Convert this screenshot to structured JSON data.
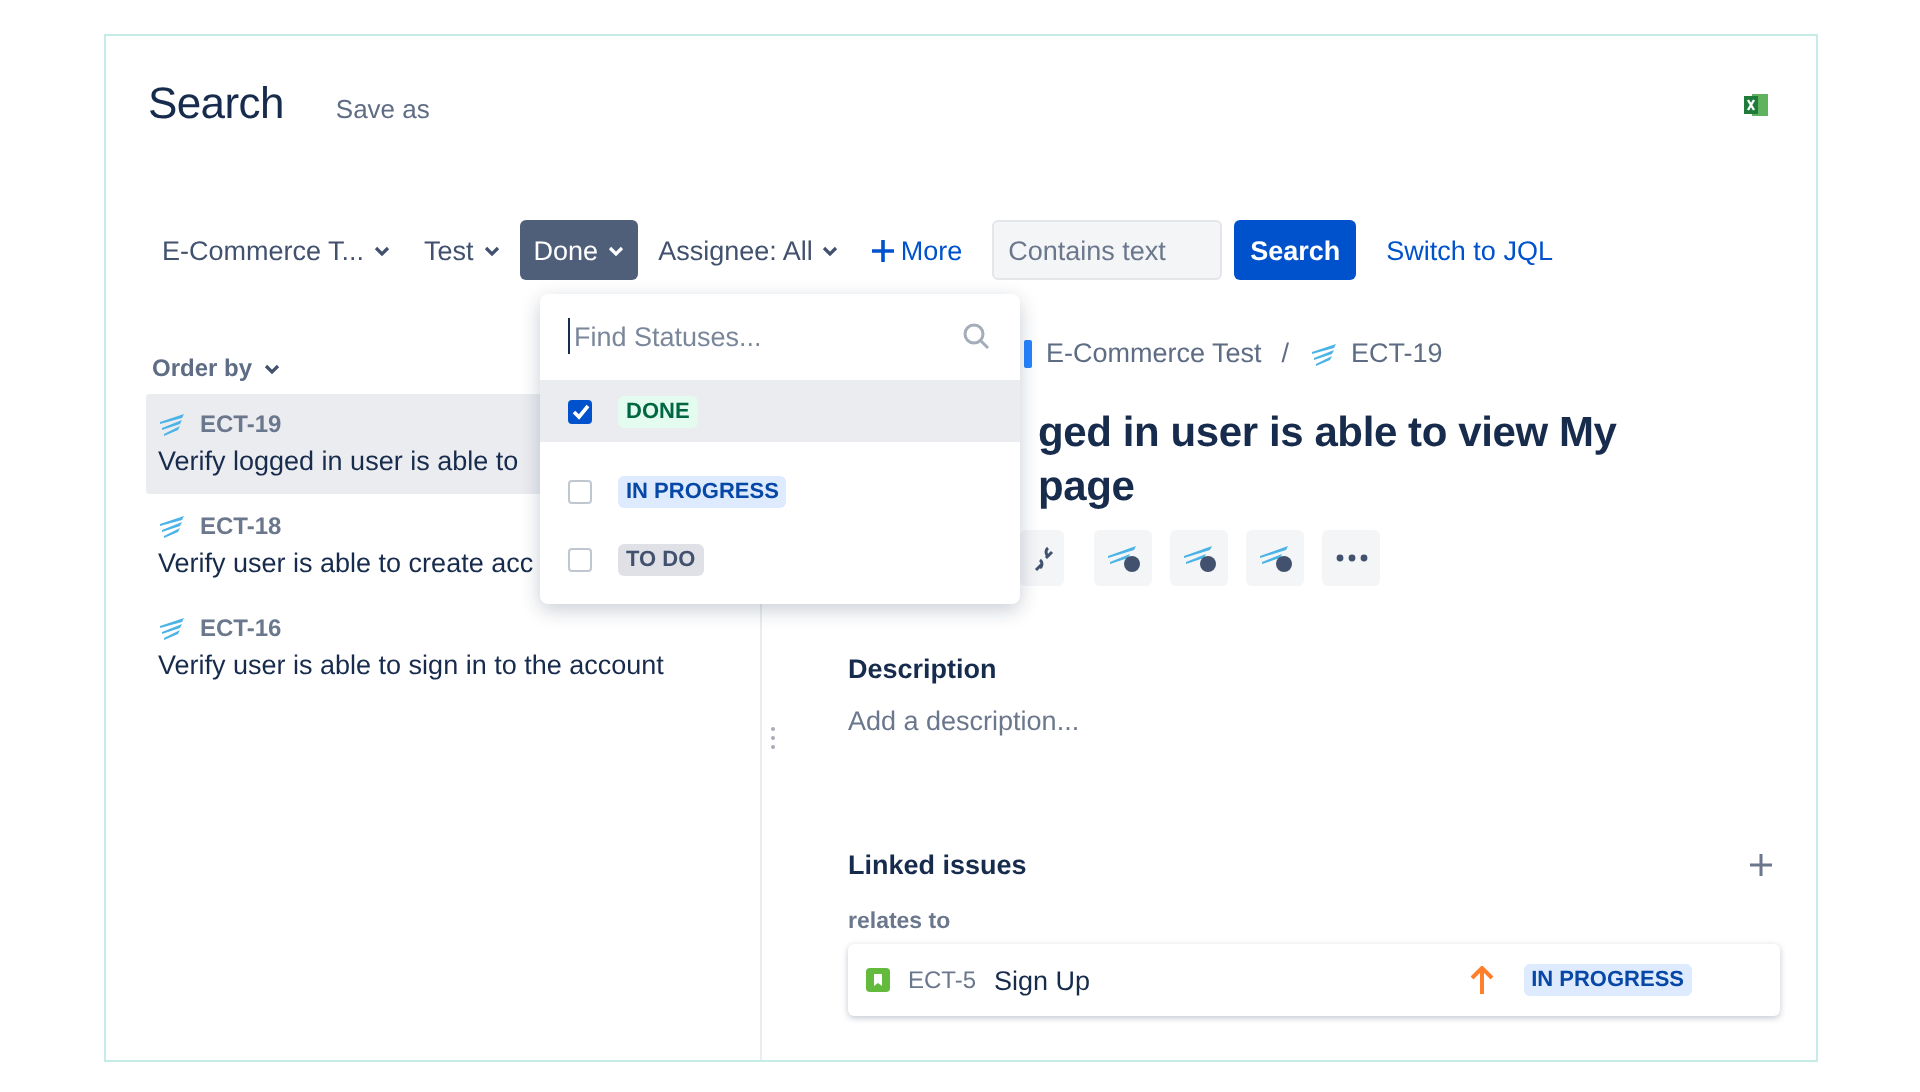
{
  "header": {
    "title": "Search",
    "save_as": "Save as"
  },
  "filters": [
    {
      "label": "E-Commerce T...",
      "selected": false
    },
    {
      "label": "Test",
      "selected": false
    },
    {
      "label": "Done",
      "selected": true
    },
    {
      "label": "Assignee: All",
      "selected": false
    }
  ],
  "more": "More",
  "text_search": {
    "placeholder": "Contains text"
  },
  "search_button": "Search",
  "jql_link": "Switch to JQL",
  "order_by": "Order by",
  "issues": [
    {
      "key": "ECT-19",
      "summary": "Verify logged in user is able to",
      "selected": true
    },
    {
      "key": "ECT-18",
      "summary": "Verify user is able to create acc",
      "selected": false
    },
    {
      "key": "ECT-16",
      "summary": "Verify user is able to sign in to the account",
      "selected": false
    }
  ],
  "status_dropdown": {
    "placeholder": "Find Statuses...",
    "options": [
      {
        "label": "DONE",
        "kind": "done",
        "checked": true,
        "selected": true
      },
      {
        "label": "IN PROGRESS",
        "kind": "inprogress",
        "checked": false,
        "selected": false
      },
      {
        "label": "TO DO",
        "kind": "todo",
        "checked": false,
        "selected": false
      }
    ]
  },
  "detail": {
    "breadcrumb": {
      "project": "E-Commerce Test",
      "separator": "/",
      "key": "ECT-19"
    },
    "title_lines": [
      "ged in user is able to view My",
      "page"
    ],
    "description": {
      "heading": "Description",
      "prompt": "Add a description..."
    },
    "linked": {
      "heading": "Linked issues",
      "relation": "relates to",
      "issues": [
        {
          "key": "ECT-5",
          "summary": "Sign Up",
          "status": "IN PROGRESS",
          "kind": "inprogress"
        }
      ]
    }
  }
}
